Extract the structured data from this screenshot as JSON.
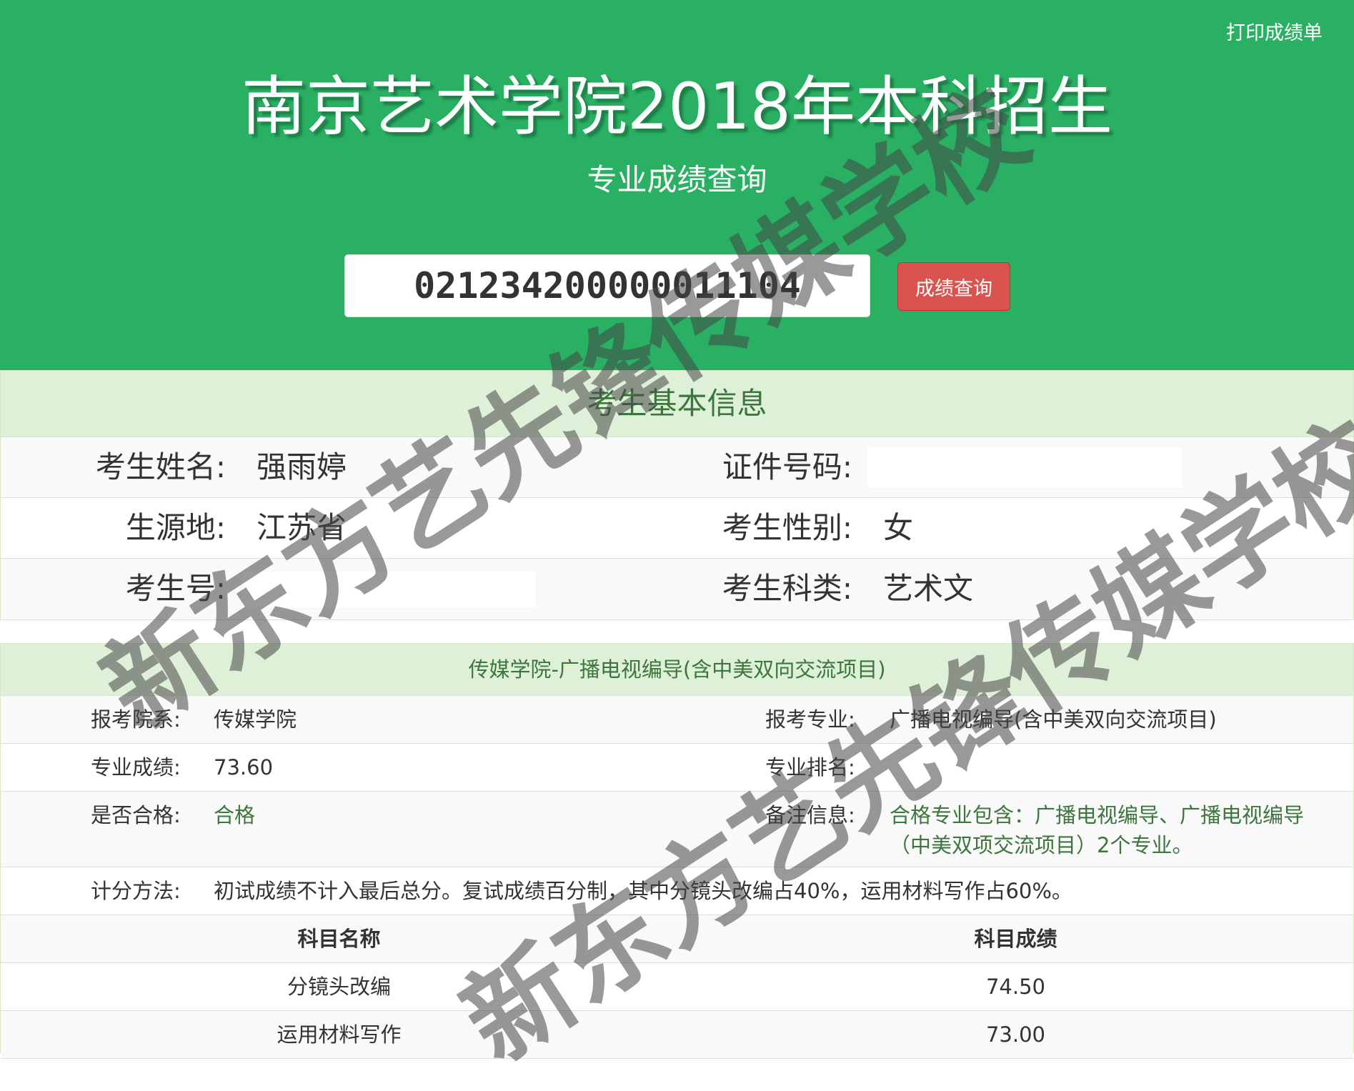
{
  "header": {
    "print_link": "打印成绩单",
    "title": "南京艺术学院2018年本科招生",
    "subtitle": "专业成绩查询",
    "search_value": "021234200000011104",
    "search_button": "成绩查询",
    "background_color": "#29b063"
  },
  "basic_info": {
    "heading": "考生基本信息",
    "name_label": "考生姓名:",
    "name_value": "强雨婷",
    "id_label": "证件号码:",
    "id_value": "",
    "origin_label": "生源地:",
    "origin_value": "江苏省",
    "gender_label": "考生性别:",
    "gender_value": "女",
    "exam_no_label": "考生号:",
    "exam_no_value": "",
    "category_label": "考生科类:",
    "category_value": "艺术文"
  },
  "major_panel": {
    "heading": "传媒学院-广播电视编导(含中美双向交流项目)",
    "department_label": "报考院系:",
    "department_value": "传媒学院",
    "major_label": "报考专业:",
    "major_value": "广播电视编导(含中美双向交流项目)",
    "score_label": "专业成绩:",
    "score_value": "73.60",
    "rank_label": "专业排名:",
    "rank_value": "",
    "qualified_label": "是否合格:",
    "qualified_value": "合格",
    "remark_label": "备注信息:",
    "remark_value": "合格专业包含：广播电视编导、广播电视编导（中美双项交流项目）2个专业。",
    "method_label": "计分方法:",
    "method_value": "初试成绩不计入最后总分。复试成绩百分制，其中分镜头改编占40%，运用材料写作占60%。",
    "table_headers": [
      "科目名称",
      "科目成绩"
    ],
    "table_rows": [
      {
        "subject": "分镜头改编",
        "score": "74.50"
      },
      {
        "subject": "运用材料写作",
        "score": "73.00"
      }
    ]
  },
  "watermark": {
    "text_1": "新东方艺先锋传媒学校",
    "text_2": "新东方艺先锋传媒学校"
  },
  "colors": {
    "accent_green": "#29b063",
    "panel_heading_bg": "#dff0d8",
    "panel_heading_text": "#3c763d",
    "danger_button": "#d9534f"
  }
}
